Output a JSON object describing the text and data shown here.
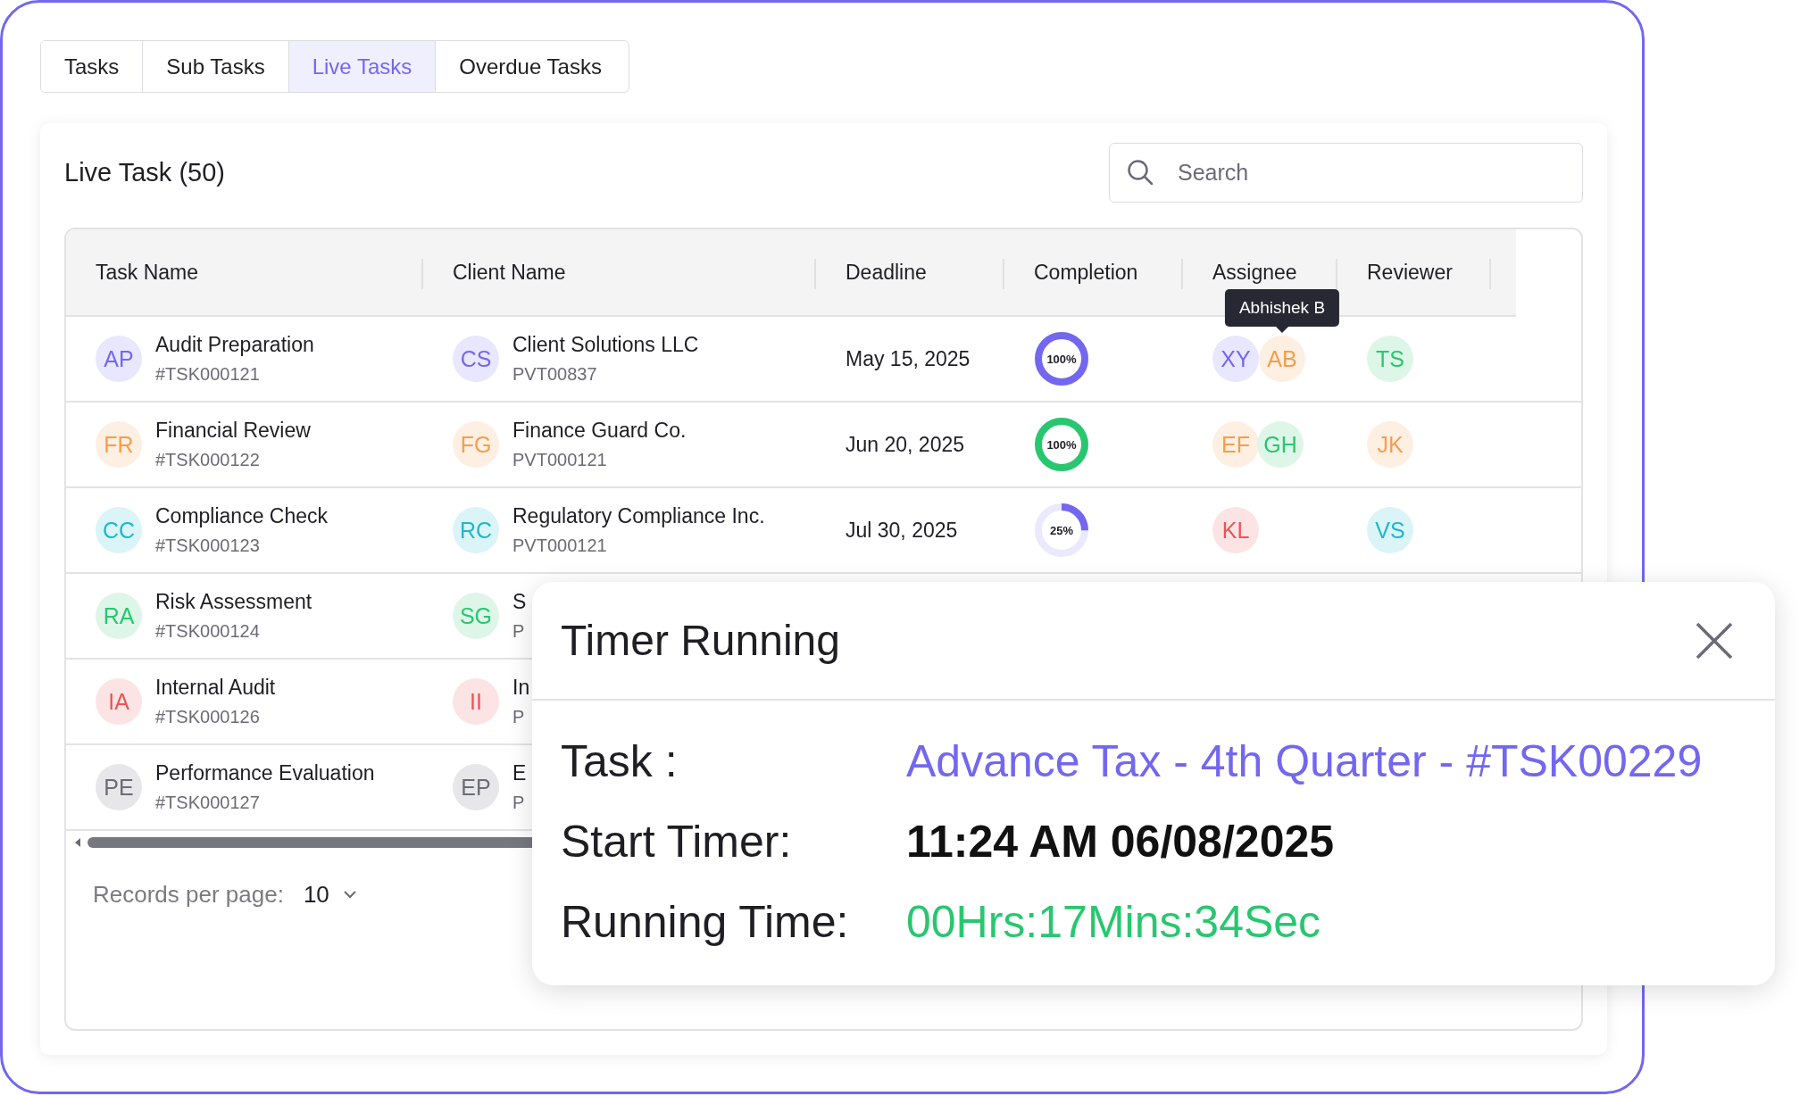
{
  "tabs": [
    {
      "label": "Tasks",
      "selected": false
    },
    {
      "label": "Sub Tasks",
      "selected": false
    },
    {
      "label": "Live Tasks",
      "selected": true
    },
    {
      "label": "Overdue Tasks",
      "selected": false
    }
  ],
  "card": {
    "title": "Live Task (50)",
    "search": {
      "placeholder": "Search"
    }
  },
  "table": {
    "columns": [
      "Task Name",
      "Client Name",
      "Deadline",
      "Completion",
      "Assignee",
      "Reviewer"
    ],
    "rows": [
      {
        "task": {
          "initials": "AP",
          "color": "#7367f0",
          "name": "Audit Preparation",
          "id": "#TSK000121"
        },
        "client": {
          "initials": "CS",
          "color": "#7367f0",
          "name": "Client Solutions LLC",
          "id": "PVT00837"
        },
        "deadline": "May 15, 2025",
        "completion": {
          "label": "100%",
          "level": 1,
          "color": "#7367f0"
        },
        "assignees": [
          {
            "initials": "XY",
            "color": "#7367f0"
          },
          {
            "initials": "AB",
            "color": "#f59e4c",
            "tooltip": "Abhishek B"
          }
        ],
        "reviewer": {
          "initials": "TS",
          "color": "#28c76f"
        }
      },
      {
        "task": {
          "initials": "FR",
          "color": "#f59e4c",
          "name": "Financial Review",
          "id": "#TSK000122"
        },
        "client": {
          "initials": "FG",
          "color": "#f59e4c",
          "name": "Finance Guard Co.",
          "id": "PVT000121"
        },
        "deadline": "Jun 20, 2025",
        "completion": {
          "label": "100%",
          "level": 1,
          "color": "#28c76f"
        },
        "assignees": [
          {
            "initials": "EF",
            "color": "#f59e4c"
          },
          {
            "initials": "GH",
            "color": "#28c76f"
          }
        ],
        "reviewer": {
          "initials": "JK",
          "color": "#f59e4c"
        }
      },
      {
        "task": {
          "initials": "CC",
          "color": "#1cb8cc",
          "name": "Compliance Check",
          "id": "#TSK000123"
        },
        "client": {
          "initials": "RC",
          "color": "#1cb8cc",
          "name": "Regulatory Compliance Inc.",
          "id": "PVT000121"
        },
        "deadline": "Jul 30, 2025",
        "completion": {
          "label": "25%",
          "level": 0.25,
          "color": "#7367f0"
        },
        "assignees": [
          {
            "initials": "KL",
            "color": "#ea5455"
          }
        ],
        "reviewer": {
          "initials": "VS",
          "color": "#1cb8cc"
        }
      },
      {
        "task": {
          "initials": "RA",
          "color": "#28c76f",
          "name": "Risk Assessment",
          "id": "#TSK000124"
        },
        "client": {
          "initials": "SG",
          "color": "#28c76f",
          "name": "S",
          "id": "P"
        }
      },
      {
        "task": {
          "initials": "IA",
          "color": "#ea5455",
          "name": "Internal Audit",
          "id": "#TSK000126"
        },
        "client": {
          "initials": "II",
          "color": "#ea5455",
          "name": "In",
          "id": "P"
        }
      },
      {
        "task": {
          "initials": "PE",
          "color": "#6b6b76",
          "name": "Performance Evaluation",
          "id": "#TSK000127"
        },
        "client": {
          "initials": "EP",
          "color": "#6b6b76",
          "name": "E",
          "id": "P"
        }
      }
    ]
  },
  "pagination": {
    "label": "Records per page:",
    "value": "10"
  },
  "timer": {
    "title": "Timer Running",
    "rows": [
      {
        "label": "Task :",
        "value": "Advance Tax - 4th Quarter - #TSK00229",
        "kind": "link"
      },
      {
        "label": "Start Timer:",
        "value": "11:24 AM 06/08/2025",
        "kind": "strong"
      },
      {
        "label": "Running Time:",
        "value": "00Hrs:17Mins:34Sec",
        "kind": "success"
      }
    ]
  }
}
